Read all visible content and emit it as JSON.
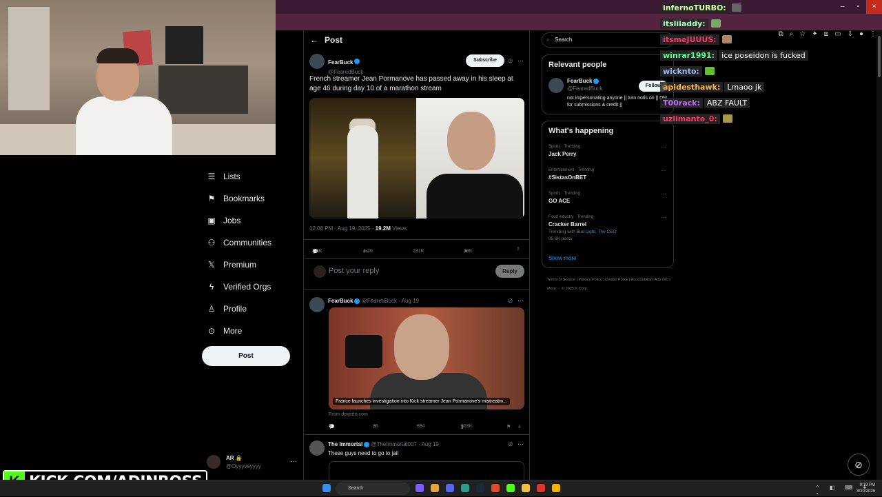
{
  "browser": {
    "window_controls": [
      "–",
      "▫",
      "×"
    ]
  },
  "stream": {
    "kick_logo": "K",
    "kick_url": "KICK.COM/ADINROSS"
  },
  "nav": {
    "items": [
      {
        "icon": "list-icon",
        "glyph": "☰",
        "label": "Lists"
      },
      {
        "icon": "bookmark-icon",
        "glyph": "⚑",
        "label": "Bookmarks"
      },
      {
        "icon": "briefcase-icon",
        "glyph": "▣",
        "label": "Jobs"
      },
      {
        "icon": "communities-icon",
        "glyph": "⚇",
        "label": "Communities"
      },
      {
        "icon": "x-logo-icon",
        "glyph": "𝕏",
        "label": "Premium"
      },
      {
        "icon": "lightning-icon",
        "glyph": "ϟ",
        "label": "Verified Orgs"
      },
      {
        "icon": "person-icon",
        "glyph": "♙",
        "label": "Profile"
      },
      {
        "icon": "more-circle-icon",
        "glyph": "⊙",
        "label": "More"
      }
    ],
    "post_button": "Post"
  },
  "account": {
    "name": "AR 🔒",
    "handle": "@Oyyyveyyyy",
    "more": "···"
  },
  "main": {
    "header_title": "Post",
    "post": {
      "author": "FearBuck",
      "handle": "@FearedBuck",
      "subscribe_label": "Subscribe",
      "text": "French streamer Jean Pormanove has passed away in his sleep at age 46 during day 10 of a marathon stream",
      "timestamp": "12:08 PM · Aug 19, 2025 · ",
      "views": "19.2M",
      "views_label": " Views",
      "replies": "1.3K",
      "reposts": "4.4K",
      "likes": "131K",
      "bookmarks": "13K"
    },
    "reply_placeholder": "Post your reply",
    "reply_button": "Reply",
    "tweet2": {
      "author": "FearBuck",
      "handle": "@FearedBuck · Aug 19",
      "card_caption": "France launches investigation into Kick streamer Jean Pormanove's mistreatm...",
      "from": "From dexerto.com",
      "replies": "8",
      "reposts": "35",
      "likes": "894",
      "views": "503K"
    },
    "tweet3": {
      "author": "The Immortal",
      "handle": "@TheImmortal007 · Aug 19",
      "text": "These guys need to go to jail"
    }
  },
  "sidebar": {
    "search_placeholder": "Search",
    "relevant_title": "Relevant people",
    "person": {
      "name": "FearBuck",
      "handle": "@FearedBuck",
      "follow_label": "Follow",
      "bio": "not impersonating anyone || turn notis on || DM for submissions & credit ||"
    },
    "happening_title": "What's happening",
    "trends": [
      {
        "category": "Sports · Trending",
        "title": "Jack Perry",
        "extra": "",
        "links": ""
      },
      {
        "category": "Entertainment · Trending",
        "title": "#SistasOnBET",
        "extra": "",
        "links": ""
      },
      {
        "category": "Sports · Trending",
        "title": "GO ACE",
        "extra": "",
        "links": ""
      },
      {
        "category": "Food industry · Trending",
        "title": "Cracker Barrel",
        "extra": "Trending with ",
        "links": "Bud Light, The CEO",
        "posts": "95.8K posts"
      }
    ],
    "show_more": "Show more",
    "footer": "Terms of Service  |  Privacy Policy  |  Cookie Policy  |  Accessibility  |  Ads info  |  More ···  © 2025 X Corp."
  },
  "chat": [
    {
      "user": "infernoTURBO:",
      "color": "#d8ffa8",
      "msg": ""
    },
    {
      "user": "itsliladdy:",
      "color": "#b6ffc7",
      "msg": ""
    },
    {
      "user": "itsmeJUUUS:",
      "color": "#ff3a6a",
      "msg": ""
    },
    {
      "user": "winrar1991:",
      "color": "#5eff95",
      "msg": "ice poseidon is fucked"
    },
    {
      "user": "wicknto:",
      "color": "#9fb9ff",
      "msg": ""
    },
    {
      "user": "apidesthawk:",
      "color": "#ffb347",
      "msg": "Lmaoo jk"
    },
    {
      "user": "T00rack:",
      "color": "#c06cff",
      "msg": "ABZ FAULT"
    },
    {
      "user": "uzlimanto_0:",
      "color": "#ff3a6a",
      "msg": ""
    }
  ],
  "taskbar": {
    "search": "Search",
    "time": "9:19 PM",
    "date": "8/20/2025"
  }
}
